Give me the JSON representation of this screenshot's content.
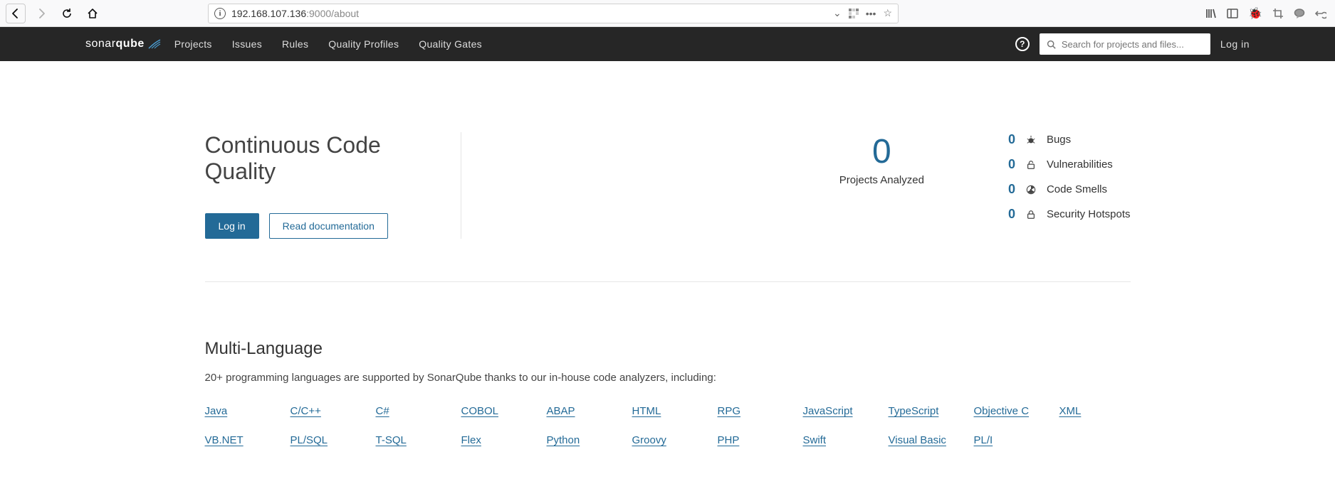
{
  "browser": {
    "url_host": "192.168.107.136",
    "url_rest": ":9000/about"
  },
  "nav": {
    "logo_prefix": "sonar",
    "logo_bold": "qube",
    "links": [
      "Projects",
      "Issues",
      "Rules",
      "Quality Profiles",
      "Quality Gates"
    ],
    "search_placeholder": "Search for projects and files...",
    "login": "Log in"
  },
  "hero": {
    "title": "Continuous Code Quality",
    "login_btn": "Log in",
    "docs_btn": "Read documentation",
    "projects_count": "0",
    "projects_label": "Projects Analyzed",
    "stats": [
      {
        "count": "0",
        "label": "Bugs"
      },
      {
        "count": "0",
        "label": "Vulnerabilities"
      },
      {
        "count": "0",
        "label": "Code Smells"
      },
      {
        "count": "0",
        "label": "Security Hotspots"
      }
    ]
  },
  "multilang": {
    "title": "Multi-Language",
    "desc": "20+ programming languages are supported by SonarQube thanks to our in-house code analyzers, including:",
    "languages": [
      "Java",
      "C/C++",
      "C#",
      "COBOL",
      "ABAP",
      "HTML",
      "RPG",
      "JavaScript",
      "TypeScript",
      "Objective C",
      "XML",
      "VB.NET",
      "PL/SQL",
      "T-SQL",
      "Flex",
      "Python",
      "Groovy",
      "PHP",
      "Swift",
      "Visual Basic",
      "PL/I"
    ]
  }
}
